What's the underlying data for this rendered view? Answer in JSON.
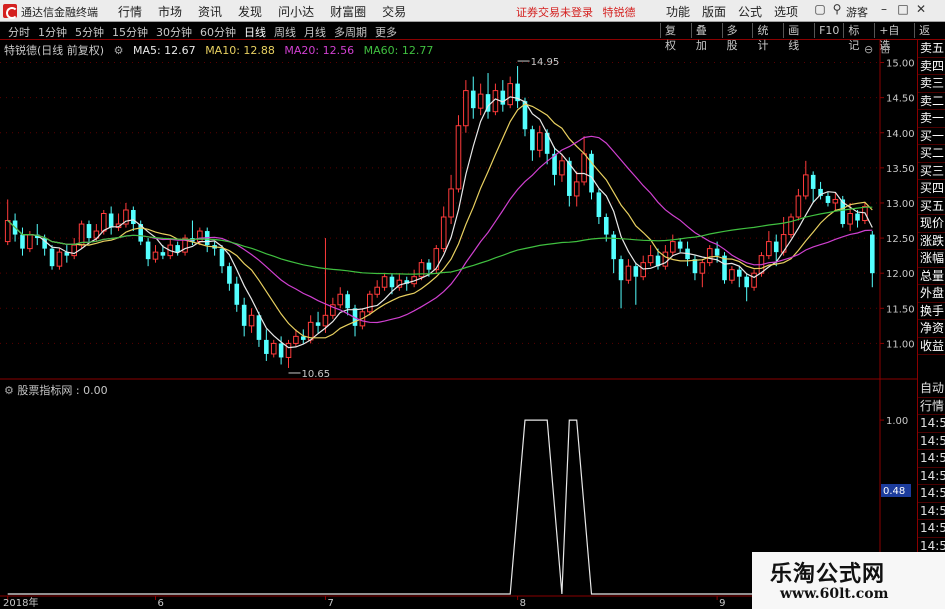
{
  "app": {
    "name": "通达信金融终端",
    "menus": [
      "行情",
      "市场",
      "资讯",
      "发现",
      "问小达",
      "财富圈",
      "交易"
    ],
    "notice": "证券交易未登录",
    "stock_name": "特锐德",
    "right_menus": [
      "功能",
      "版面",
      "公式",
      "选项"
    ],
    "guest": "游客",
    "colors": {
      "up": "#ff3b3b",
      "down": "#54ffff",
      "ma5": "#e8e8e8",
      "ma10": "#e8d060",
      "ma20": "#d040d0",
      "ma60": "#40c040",
      "grid": "#5a0000"
    }
  },
  "toolbar": {
    "periods": [
      "分时",
      "1分钟",
      "5分钟",
      "15分钟",
      "30分钟",
      "60分钟",
      "日线",
      "周线",
      "月线",
      "多周期",
      "更多"
    ],
    "active_period": "日线",
    "buttons": [
      "复权",
      "叠加",
      "多股",
      "统计",
      "画线",
      "F10",
      "标记",
      "+自选",
      "返回"
    ]
  },
  "indicators": {
    "title": "特锐德(日线 前复权)",
    "ma5": "MA5: 12.67",
    "ma10": "MA10: 12.88",
    "ma20": "MA20: 12.56",
    "ma60": "MA60: 12.77"
  },
  "lower_indicator": {
    "label": "股票指标网 : 0.00",
    "value_tag": "0.48"
  },
  "side_panel": [
    "卖五",
    "卖四",
    "卖三",
    "卖二",
    "卖一",
    "买一",
    "买二",
    "买三",
    "买四",
    "买五",
    "现价",
    "涨跌",
    "涨幅",
    "总量",
    "外盘",
    "换手",
    "净资",
    "收益"
  ],
  "side_panel_lower": [
    "自动",
    "行情",
    "14:50",
    "14:50",
    "14:50",
    "14:50",
    "14:50",
    "14:50",
    "14:50",
    "14:50",
    "14:50",
    "14:50"
  ],
  "watermark": {
    "line1": "乐淘公式网",
    "line2": "www.60lt.com"
  },
  "chart_data": {
    "type": "candlestick",
    "y_ticks": [
      "15.00",
      "14.50",
      "14.00",
      "13.50",
      "13.00",
      "12.50",
      "12.00",
      "11.50",
      "11.00"
    ],
    "ylim": [
      10.55,
      15.15
    ],
    "annotations": [
      {
        "label": "14.95",
        "index": 69,
        "value": 14.95
      },
      {
        "label": "10.65",
        "index": 38,
        "value": 10.65
      }
    ],
    "x_labels": [
      {
        "label": "2018年",
        "index": 0
      },
      {
        "label": "6",
        "index": 20
      },
      {
        "label": "7",
        "index": 43
      },
      {
        "label": "8",
        "index": 69
      },
      {
        "label": "9",
        "index": 96
      }
    ],
    "candles": [
      {
        "o": 12.45,
        "c": 12.75,
        "h": 13.05,
        "l": 12.4
      },
      {
        "o": 12.75,
        "c": 12.55,
        "h": 12.85,
        "l": 12.45
      },
      {
        "o": 12.55,
        "c": 12.35,
        "h": 12.65,
        "l": 12.25
      },
      {
        "o": 12.35,
        "c": 12.55,
        "h": 12.6,
        "l": 12.3
      },
      {
        "o": 12.55,
        "c": 12.5,
        "h": 12.7,
        "l": 12.4
      },
      {
        "o": 12.5,
        "c": 12.35,
        "h": 12.55,
        "l": 12.25
      },
      {
        "o": 12.35,
        "c": 12.1,
        "h": 12.4,
        "l": 12.05
      },
      {
        "o": 12.1,
        "c": 12.3,
        "h": 12.35,
        "l": 12.05
      },
      {
        "o": 12.3,
        "c": 12.25,
        "h": 12.4,
        "l": 12.15
      },
      {
        "o": 12.25,
        "c": 12.4,
        "h": 12.5,
        "l": 12.2
      },
      {
        "o": 12.4,
        "c": 12.7,
        "h": 12.75,
        "l": 12.35
      },
      {
        "o": 12.7,
        "c": 12.5,
        "h": 12.75,
        "l": 12.45
      },
      {
        "o": 12.5,
        "c": 12.6,
        "h": 12.7,
        "l": 12.45
      },
      {
        "o": 12.6,
        "c": 12.85,
        "h": 12.9,
        "l": 12.55
      },
      {
        "o": 12.85,
        "c": 12.65,
        "h": 12.95,
        "l": 12.55
      },
      {
        "o": 12.65,
        "c": 12.7,
        "h": 12.85,
        "l": 12.6
      },
      {
        "o": 12.7,
        "c": 12.9,
        "h": 13.0,
        "l": 12.65
      },
      {
        "o": 12.9,
        "c": 12.7,
        "h": 12.95,
        "l": 12.6
      },
      {
        "o": 12.7,
        "c": 12.45,
        "h": 12.75,
        "l": 12.4
      },
      {
        "o": 12.45,
        "c": 12.2,
        "h": 12.5,
        "l": 12.1
      },
      {
        "o": 12.2,
        "c": 12.3,
        "h": 12.4,
        "l": 12.15
      },
      {
        "o": 12.3,
        "c": 12.25,
        "h": 12.4,
        "l": 12.2
      },
      {
        "o": 12.25,
        "c": 12.4,
        "h": 12.5,
        "l": 12.2
      },
      {
        "o": 12.4,
        "c": 12.3,
        "h": 12.45,
        "l": 12.25
      },
      {
        "o": 12.3,
        "c": 12.5,
        "h": 12.55,
        "l": 12.25
      },
      {
        "o": 12.5,
        "c": 12.45,
        "h": 12.75,
        "l": 12.4
      },
      {
        "o": 12.45,
        "c": 12.6,
        "h": 12.65,
        "l": 12.4
      },
      {
        "o": 12.6,
        "c": 12.4,
        "h": 12.65,
        "l": 12.3
      },
      {
        "o": 12.4,
        "c": 12.35,
        "h": 12.45,
        "l": 12.25
      },
      {
        "o": 12.35,
        "c": 12.1,
        "h": 12.4,
        "l": 12.0
      },
      {
        "o": 12.1,
        "c": 11.85,
        "h": 12.15,
        "l": 11.75
      },
      {
        "o": 11.85,
        "c": 11.55,
        "h": 11.95,
        "l": 11.45
      },
      {
        "o": 11.55,
        "c": 11.25,
        "h": 11.65,
        "l": 11.1
      },
      {
        "o": 11.25,
        "c": 11.4,
        "h": 11.5,
        "l": 11.15
      },
      {
        "o": 11.4,
        "c": 11.05,
        "h": 11.45,
        "l": 10.95
      },
      {
        "o": 11.05,
        "c": 10.85,
        "h": 11.2,
        "l": 10.75
      },
      {
        "o": 10.85,
        "c": 11.0,
        "h": 11.05,
        "l": 10.8
      },
      {
        "o": 11.0,
        "c": 10.8,
        "h": 11.1,
        "l": 10.7
      },
      {
        "o": 10.8,
        "c": 11.0,
        "h": 11.05,
        "l": 10.65
      },
      {
        "o": 11.0,
        "c": 11.1,
        "h": 11.2,
        "l": 10.95
      },
      {
        "o": 11.1,
        "c": 11.05,
        "h": 11.2,
        "l": 11.0
      },
      {
        "o": 11.05,
        "c": 11.3,
        "h": 11.4,
        "l": 11.0
      },
      {
        "o": 11.3,
        "c": 11.25,
        "h": 11.45,
        "l": 11.15
      },
      {
        "o": 11.25,
        "c": 11.4,
        "h": 12.5,
        "l": 11.15
      },
      {
        "o": 11.4,
        "c": 11.55,
        "h": 11.65,
        "l": 11.35
      },
      {
        "o": 11.55,
        "c": 11.7,
        "h": 11.8,
        "l": 11.5
      },
      {
        "o": 11.7,
        "c": 11.5,
        "h": 11.75,
        "l": 11.4
      },
      {
        "o": 11.5,
        "c": 11.25,
        "h": 11.55,
        "l": 11.1
      },
      {
        "o": 11.25,
        "c": 11.45,
        "h": 11.5,
        "l": 11.2
      },
      {
        "o": 11.45,
        "c": 11.7,
        "h": 11.75,
        "l": 11.4
      },
      {
        "o": 11.7,
        "c": 11.8,
        "h": 11.9,
        "l": 11.65
      },
      {
        "o": 11.8,
        "c": 11.95,
        "h": 12.0,
        "l": 11.75
      },
      {
        "o": 11.95,
        "c": 11.8,
        "h": 12.0,
        "l": 11.7
      },
      {
        "o": 11.8,
        "c": 11.9,
        "h": 12.0,
        "l": 11.75
      },
      {
        "o": 11.9,
        "c": 11.85,
        "h": 11.95,
        "l": 11.75
      },
      {
        "o": 11.85,
        "c": 11.95,
        "h": 12.05,
        "l": 11.8
      },
      {
        "o": 11.95,
        "c": 12.15,
        "h": 12.2,
        "l": 11.9
      },
      {
        "o": 12.15,
        "c": 12.05,
        "h": 12.2,
        "l": 11.95
      },
      {
        "o": 12.05,
        "c": 12.35,
        "h": 12.4,
        "l": 12.0
      },
      {
        "o": 12.35,
        "c": 12.8,
        "h": 12.95,
        "l": 12.3
      },
      {
        "o": 12.8,
        "c": 13.2,
        "h": 13.4,
        "l": 12.7
      },
      {
        "o": 13.2,
        "c": 14.1,
        "h": 14.25,
        "l": 13.15
      },
      {
        "o": 14.1,
        "c": 14.6,
        "h": 14.75,
        "l": 14.0
      },
      {
        "o": 14.6,
        "c": 14.35,
        "h": 14.8,
        "l": 14.2
      },
      {
        "o": 14.35,
        "c": 14.55,
        "h": 14.7,
        "l": 14.25
      },
      {
        "o": 14.55,
        "c": 14.3,
        "h": 14.85,
        "l": 14.2
      },
      {
        "o": 14.3,
        "c": 14.6,
        "h": 14.7,
        "l": 14.25
      },
      {
        "o": 14.6,
        "c": 14.4,
        "h": 14.75,
        "l": 14.3
      },
      {
        "o": 14.4,
        "c": 14.7,
        "h": 14.8,
        "l": 14.35
      },
      {
        "o": 14.7,
        "c": 14.45,
        "h": 14.95,
        "l": 14.35
      },
      {
        "o": 14.45,
        "c": 14.05,
        "h": 14.5,
        "l": 13.95
      },
      {
        "o": 14.05,
        "c": 13.75,
        "h": 14.1,
        "l": 13.6
      },
      {
        "o": 13.75,
        "c": 14.0,
        "h": 14.1,
        "l": 13.65
      },
      {
        "o": 14.0,
        "c": 13.7,
        "h": 14.05,
        "l": 13.55
      },
      {
        "o": 13.7,
        "c": 13.4,
        "h": 13.8,
        "l": 13.25
      },
      {
        "o": 13.4,
        "c": 13.6,
        "h": 13.7,
        "l": 13.3
      },
      {
        "o": 13.6,
        "c": 13.1,
        "h": 13.65,
        "l": 12.95
      },
      {
        "o": 13.1,
        "c": 13.3,
        "h": 13.45,
        "l": 12.95
      },
      {
        "o": 13.3,
        "c": 13.7,
        "h": 13.95,
        "l": 13.25
      },
      {
        "o": 13.7,
        "c": 13.15,
        "h": 13.75,
        "l": 13.05
      },
      {
        "o": 13.15,
        "c": 12.8,
        "h": 13.2,
        "l": 12.7
      },
      {
        "o": 12.8,
        "c": 12.55,
        "h": 12.85,
        "l": 12.45
      },
      {
        "o": 12.55,
        "c": 12.2,
        "h": 12.6,
        "l": 12.0
      },
      {
        "o": 12.2,
        "c": 11.9,
        "h": 12.25,
        "l": 11.5
      },
      {
        "o": 11.9,
        "c": 12.1,
        "h": 12.2,
        "l": 11.85
      },
      {
        "o": 12.1,
        "c": 11.95,
        "h": 12.15,
        "l": 11.55
      },
      {
        "o": 11.95,
        "c": 12.15,
        "h": 12.25,
        "l": 11.9
      },
      {
        "o": 12.15,
        "c": 12.25,
        "h": 12.4,
        "l": 12.1
      },
      {
        "o": 12.25,
        "c": 12.1,
        "h": 12.35,
        "l": 12.05
      },
      {
        "o": 12.1,
        "c": 12.3,
        "h": 12.4,
        "l": 12.05
      },
      {
        "o": 12.3,
        "c": 12.45,
        "h": 12.55,
        "l": 12.25
      },
      {
        "o": 12.45,
        "c": 12.35,
        "h": 12.5,
        "l": 12.3
      },
      {
        "o": 12.35,
        "c": 12.2,
        "h": 12.45,
        "l": 12.1
      },
      {
        "o": 12.2,
        "c": 12.0,
        "h": 12.25,
        "l": 11.9
      },
      {
        "o": 12.0,
        "c": 12.15,
        "h": 12.2,
        "l": 11.8
      },
      {
        "o": 12.15,
        "c": 12.35,
        "h": 12.4,
        "l": 12.1
      },
      {
        "o": 12.35,
        "c": 12.25,
        "h": 12.45,
        "l": 12.15
      },
      {
        "o": 12.25,
        "c": 11.9,
        "h": 12.3,
        "l": 11.85
      },
      {
        "o": 11.9,
        "c": 12.05,
        "h": 12.1,
        "l": 11.85
      },
      {
        "o": 12.05,
        "c": 11.95,
        "h": 12.1,
        "l": 11.8
      },
      {
        "o": 11.95,
        "c": 11.8,
        "h": 12.0,
        "l": 11.6
      },
      {
        "o": 11.8,
        "c": 12.0,
        "h": 12.05,
        "l": 11.75
      },
      {
        "o": 12.0,
        "c": 12.25,
        "h": 12.3,
        "l": 11.95
      },
      {
        "o": 12.25,
        "c": 12.45,
        "h": 12.6,
        "l": 12.2
      },
      {
        "o": 12.45,
        "c": 12.3,
        "h": 12.55,
        "l": 12.1
      },
      {
        "o": 12.3,
        "c": 12.55,
        "h": 12.8,
        "l": 12.25
      },
      {
        "o": 12.55,
        "c": 12.8,
        "h": 12.85,
        "l": 12.5
      },
      {
        "o": 12.8,
        "c": 13.1,
        "h": 13.2,
        "l": 12.75
      },
      {
        "o": 13.1,
        "c": 13.4,
        "h": 13.6,
        "l": 13.05
      },
      {
        "o": 13.4,
        "c": 13.2,
        "h": 13.45,
        "l": 13.0
      },
      {
        "o": 13.2,
        "c": 13.1,
        "h": 13.3,
        "l": 13.05
      },
      {
        "o": 13.1,
        "c": 13.0,
        "h": 13.15,
        "l": 12.95
      },
      {
        "o": 13.0,
        "c": 13.05,
        "h": 13.15,
        "l": 12.9
      },
      {
        "o": 13.05,
        "c": 12.7,
        "h": 13.1,
        "l": 12.65
      },
      {
        "o": 12.7,
        "c": 12.85,
        "h": 13.0,
        "l": 12.6
      },
      {
        "o": 12.85,
        "c": 12.75,
        "h": 12.9,
        "l": 12.65
      },
      {
        "o": 12.75,
        "c": 12.95,
        "h": 13.0,
        "l": 12.7
      },
      {
        "o": 12.55,
        "c": 12.0,
        "h": 12.6,
        "l": 11.8
      }
    ],
    "lower_ylim": [
      0,
      1.15
    ],
    "lower_y_ticks": [
      "1.00"
    ],
    "lower_series": [
      {
        "index": 0,
        "value": 0
      },
      {
        "index": 68,
        "value": 0
      },
      {
        "index": 70,
        "value": 1
      },
      {
        "index": 73,
        "value": 1
      },
      {
        "index": 75,
        "value": 0
      },
      {
        "index": 76,
        "value": 1
      },
      {
        "index": 77,
        "value": 1
      },
      {
        "index": 79,
        "value": 0
      },
      {
        "index": 118,
        "value": 0
      }
    ]
  }
}
